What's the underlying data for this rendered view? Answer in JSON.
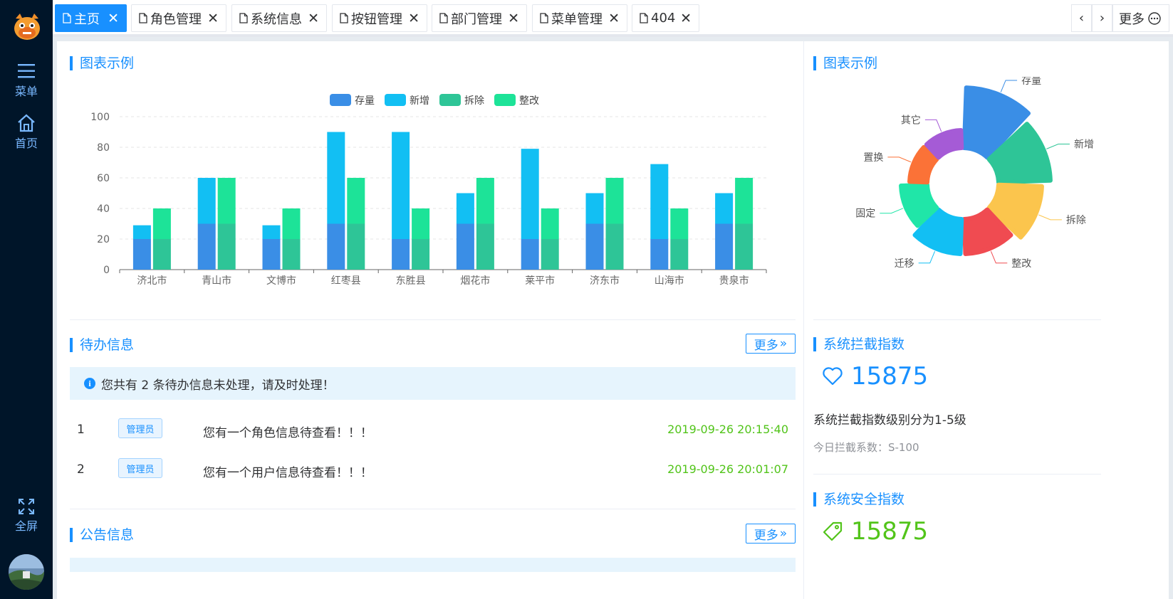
{
  "sidebar": {
    "menu_label": "菜单",
    "home_label": "首页",
    "fullscreen_label": "全屏"
  },
  "tabs": [
    {
      "label": "主页",
      "active": true
    },
    {
      "label": "角色管理",
      "active": false
    },
    {
      "label": "系统信息",
      "active": false
    },
    {
      "label": "按钮管理",
      "active": false
    },
    {
      "label": "部门管理",
      "active": false
    },
    {
      "label": "菜单管理",
      "active": false
    },
    {
      "label": "404",
      "active": false
    }
  ],
  "tab_controls": {
    "prev": "‹",
    "next": "›",
    "more_label": "更多"
  },
  "bar_panel": {
    "title": "图表示例"
  },
  "pie_panel": {
    "title": "图表示例"
  },
  "todo": {
    "title": "待办信息",
    "more_label": "更多",
    "notice": "您共有 2 条待办信息未处理，请及时处理！",
    "rows": [
      {
        "index": "1",
        "role": "管理员",
        "message": "您有一个角色信息待查看！！！",
        "time": "2019-09-26 20:15:40"
      },
      {
        "index": "2",
        "role": "管理员",
        "message": "您有一个用户信息待查看！！！",
        "time": "2019-09-26 20:01:07"
      }
    ]
  },
  "announcement": {
    "title": "公告信息",
    "more_label": "更多"
  },
  "intercept": {
    "title": "系统拦截指数",
    "value": "15875",
    "desc": "系统拦截指数级别分为1-5级",
    "today": "今日拦截系数：S-100"
  },
  "security": {
    "title": "系统安全指数",
    "value": "15875"
  },
  "colors": {
    "accent": "#1890ff",
    "green": "#52c41a"
  },
  "chart_data": [
    {
      "type": "bar",
      "stacked": true,
      "categories": [
        "济北市",
        "青山市",
        "文博市",
        "红枣县",
        "东胜县",
        "烟花市",
        "莱平市",
        "济东市",
        "山海市",
        "贵泉市"
      ],
      "series": [
        {
          "name": "存量",
          "stack": "a",
          "color": "#3a8ee6",
          "values": [
            20,
            30,
            20,
            30,
            20,
            30,
            20,
            30,
            20,
            30
          ]
        },
        {
          "name": "新增",
          "stack": "a",
          "color": "#12bff3",
          "values": [
            9,
            30,
            9,
            60,
            70,
            20,
            59,
            20,
            49,
            20
          ]
        },
        {
          "name": "拆除",
          "stack": "b",
          "color": "#2ec597",
          "values": [
            20,
            30,
            20,
            30,
            20,
            30,
            20,
            30,
            20,
            30
          ]
        },
        {
          "name": "整改",
          "stack": "b",
          "color": "#1de398",
          "values": [
            20,
            30,
            20,
            30,
            20,
            30,
            20,
            30,
            20,
            30
          ]
        }
      ],
      "yticks": [
        "0",
        "20",
        "40",
        "60",
        "80",
        "100"
      ],
      "ylim": [
        0,
        100
      ],
      "legend": "top-center",
      "grid": true
    },
    {
      "type": "pie",
      "rose": true,
      "slices": [
        {
          "name": "存量",
          "value": 10,
          "color": "#3a8ee6"
        },
        {
          "name": "新增",
          "value": 9,
          "color": "#2ec597"
        },
        {
          "name": "拆除",
          "value": 8,
          "color": "#fbc54d"
        },
        {
          "name": "整改",
          "value": 7,
          "color": "#f04b51"
        },
        {
          "name": "迁移",
          "value": 7,
          "color": "#12bff3"
        },
        {
          "name": "固定",
          "value": 6,
          "color": "#20e6a8"
        },
        {
          "name": "置换",
          "value": 5,
          "color": "#fb7237"
        },
        {
          "name": "其它",
          "value": 5,
          "color": "#a55bd6"
        }
      ],
      "legend": "none"
    }
  ]
}
